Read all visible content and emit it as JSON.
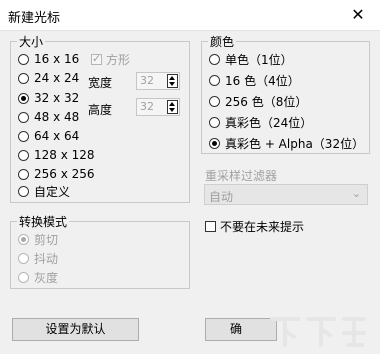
{
  "window": {
    "title": "新建光标",
    "close_glyph": "✕"
  },
  "size_group": {
    "legend": "大小",
    "options": [
      "16 x 16",
      "24 x 24",
      "32 x 32",
      "48 x 48",
      "64 x 64",
      "128 x 128",
      "256 x 256",
      "自定义"
    ],
    "selected": "32 x 32",
    "square_label": "方形",
    "width_label": "宽度",
    "width_value": "32",
    "height_label": "高度",
    "height_value": "32"
  },
  "color_group": {
    "legend": "颜色",
    "options": [
      "单色（1位）",
      "16 色（4位）",
      "256 色（8位）",
      "真彩色（24位）",
      "真彩色 + Alpha（32位）"
    ],
    "selected": "真彩色 + Alpha（32位）"
  },
  "resample": {
    "label": "重采样过滤器",
    "value": "自动"
  },
  "dont_show_label": "不要在未来提示",
  "convert_group": {
    "legend": "转换模式",
    "options": [
      "剪切",
      "抖动",
      "灰度"
    ],
    "selected": "剪切"
  },
  "buttons": {
    "default_label": "设置为默认",
    "ok_label": "确"
  },
  "watermark": {
    "text": "下载吧"
  }
}
